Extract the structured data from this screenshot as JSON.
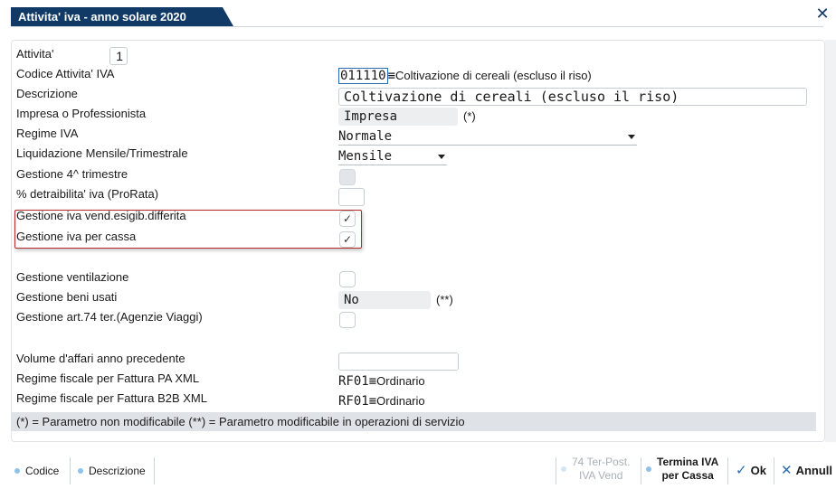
{
  "window": {
    "title": "Attivita' iva - anno solare 2020"
  },
  "fields": {
    "attivita": {
      "label": "Attivita'",
      "value": "1"
    },
    "codice_attivita": {
      "label": "Codice Attivita' IVA",
      "code": "011110",
      "separator": "≡",
      "desc": "Coltivazione di cereali (escluso il riso)"
    },
    "descrizione": {
      "label": "Descrizione",
      "value": "Coltivazione di cereali (escluso il riso)"
    },
    "impresa": {
      "label": "Impresa o Professionista",
      "value": "Impresa",
      "suffix": "(*)"
    },
    "regime_iva": {
      "label": "Regime IVA",
      "value": "Normale"
    },
    "liquidazione": {
      "label": "Liquidazione Mensile/Trimestrale",
      "value": "Mensile"
    },
    "gestione_4_trim": {
      "label": "Gestione 4^ trimestre",
      "checked": false
    },
    "detraibilita": {
      "label": "% detraibilita' iva (ProRata)",
      "value": ""
    },
    "iva_vend_diff": {
      "label": "Gestione iva vend.esigib.differita",
      "checked": true,
      "mark": "✓"
    },
    "iva_per_cassa": {
      "label": "Gestione iva per cassa",
      "checked": true,
      "mark": "✓"
    },
    "ventilazione": {
      "label": "Gestione ventilazione",
      "checked": false
    },
    "beni_usati": {
      "label": "Gestione beni usati",
      "value": "No",
      "suffix": "(**)"
    },
    "art74": {
      "label": "Gestione art.74 ter.(Agenzie Viaggi)",
      "checked": false
    },
    "volume_affari": {
      "label": "Volume d'affari anno precedente",
      "value": ""
    },
    "regime_pa": {
      "label": "Regime fiscale per Fattura PA XML",
      "code": "RF01",
      "separator": "≡",
      "desc": "Ordinario"
    },
    "regime_b2b": {
      "label": "Regime fiscale per Fattura B2B XML",
      "code": "RF01",
      "separator": "≡",
      "desc": "Ordinario"
    }
  },
  "note": "(*) = Parametro non modificabile   (**) = Parametro modificabile in operazioni di servizio",
  "pager": {
    "label": "1/"
  },
  "toolbar": {
    "codice": "Codice",
    "descrizione": "Descrizione",
    "ter_post_line1": "74 Ter-Post.",
    "ter_post_line2": "IVA Vend",
    "termina_line1": "Termina IVA",
    "termina_line2": "per Cassa",
    "ok": "Ok",
    "annulla": "Annull"
  },
  "colors": {
    "title_bg": "#123a66",
    "accent": "#2b6cb0",
    "highlight_border": "#b52a2a"
  }
}
